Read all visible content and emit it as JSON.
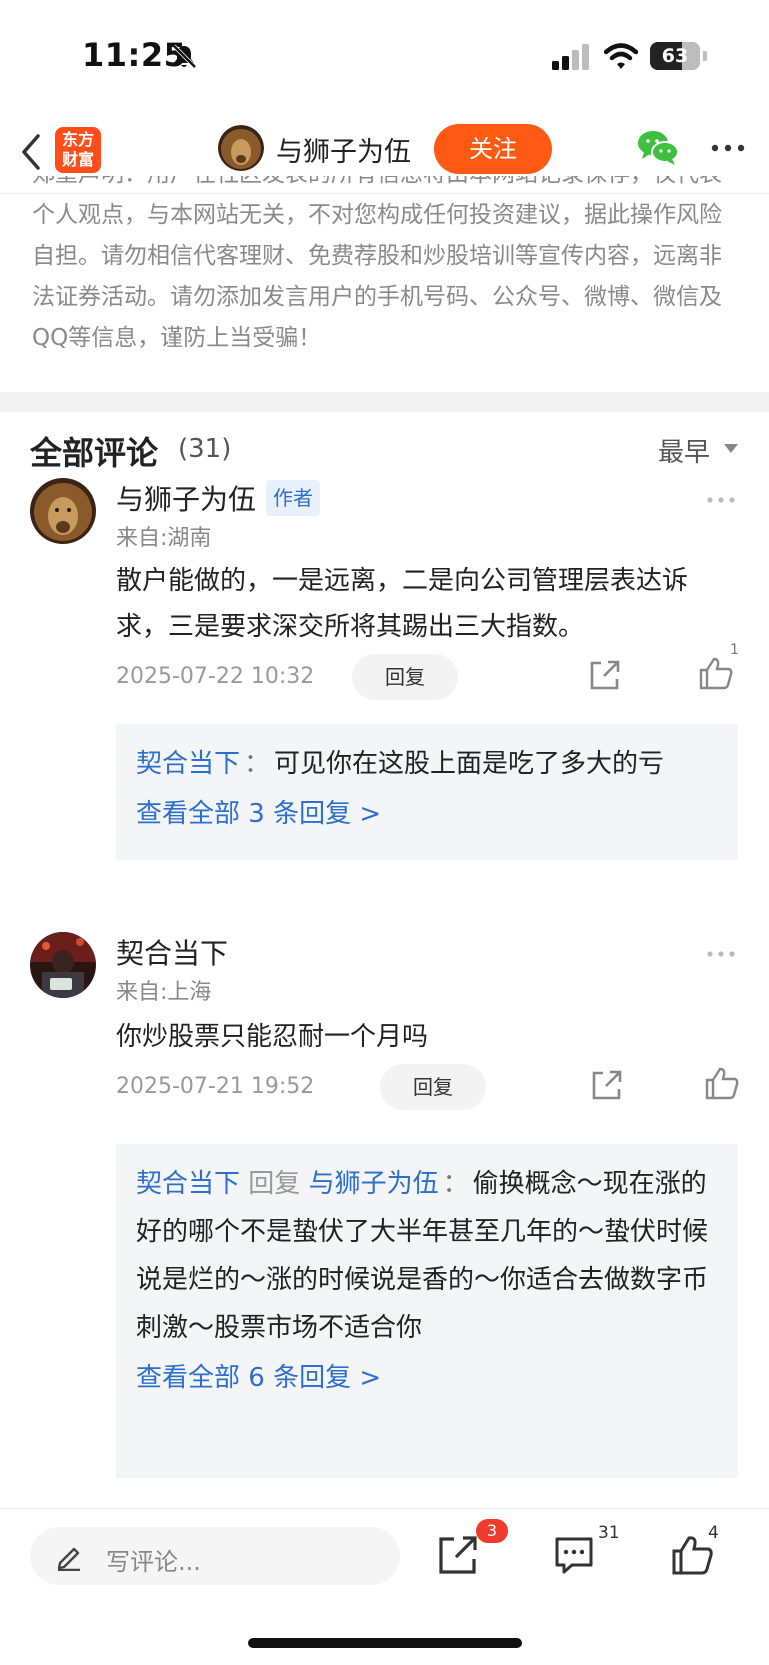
{
  "status_bar": {
    "time": "11:25",
    "battery": "63",
    "battery_fraction": 0.63,
    "icons": [
      "bell-slash-icon",
      "cellular-signal-icon",
      "wifi-icon",
      "battery-icon"
    ]
  },
  "nav": {
    "logo": "东方财富",
    "author": "与狮子为伍",
    "follow_label": "关注",
    "icons": [
      "back-chevron-icon",
      "wechat-icon",
      "more-dots-icon"
    ]
  },
  "disclaimer": "郑重声明：用户在社区发表的所有信息将由本网站记录保存，仅代表个人观点，与本网站无关，不对您构成任何投资建议，据此操作风险自担。请勿相信代客理财、免费荐股和炒股培训等宣传内容，远离非法证券活动。请勿添加发言用户的手机号码、公众号、微博、微信及QQ等信息，谨防上当受骗！",
  "comments_header": {
    "title": "全部评论",
    "count": "(31)",
    "sort": "最早"
  },
  "comments": [
    {
      "name": "与狮子为伍",
      "badge": "作者",
      "location": "来自:湖南",
      "body": "散户能做的，一是远离，二是向公司管理层表达诉求，三是要求深交所将其踢出三大指数。",
      "time": "2025-07-22 10:32",
      "reply_label": "回复",
      "likes": "1",
      "replies": [
        {
          "user": "契合当下",
          "sep": "：",
          "text": "可见你在这股上面是吃了多大的亏"
        }
      ],
      "view_all": "查看全部 3 条回复 >"
    },
    {
      "name": "契合当下",
      "badge": "",
      "location": "来自:上海",
      "body": "你炒股票只能忍耐一个月吗",
      "time": "2025-07-21 19:52",
      "reply_label": "回复",
      "likes": "",
      "replies": [
        {
          "user": "契合当下",
          "reply_word": "回复",
          "to": "与狮子为伍",
          "sep": "：",
          "text": "偷换概念～现在涨的好的哪个不是蛰伏了大半年甚至几年的～蛰伏时候说是烂的～涨的时候说是香的～你适合去做数字币刺激～股票市场不适合你"
        }
      ],
      "view_all": "查看全部 6 条回复 >"
    }
  ],
  "bottom_bar": {
    "placeholder": "写评论...",
    "share_badge": "3",
    "comment_count": "31",
    "like_count": "4"
  }
}
